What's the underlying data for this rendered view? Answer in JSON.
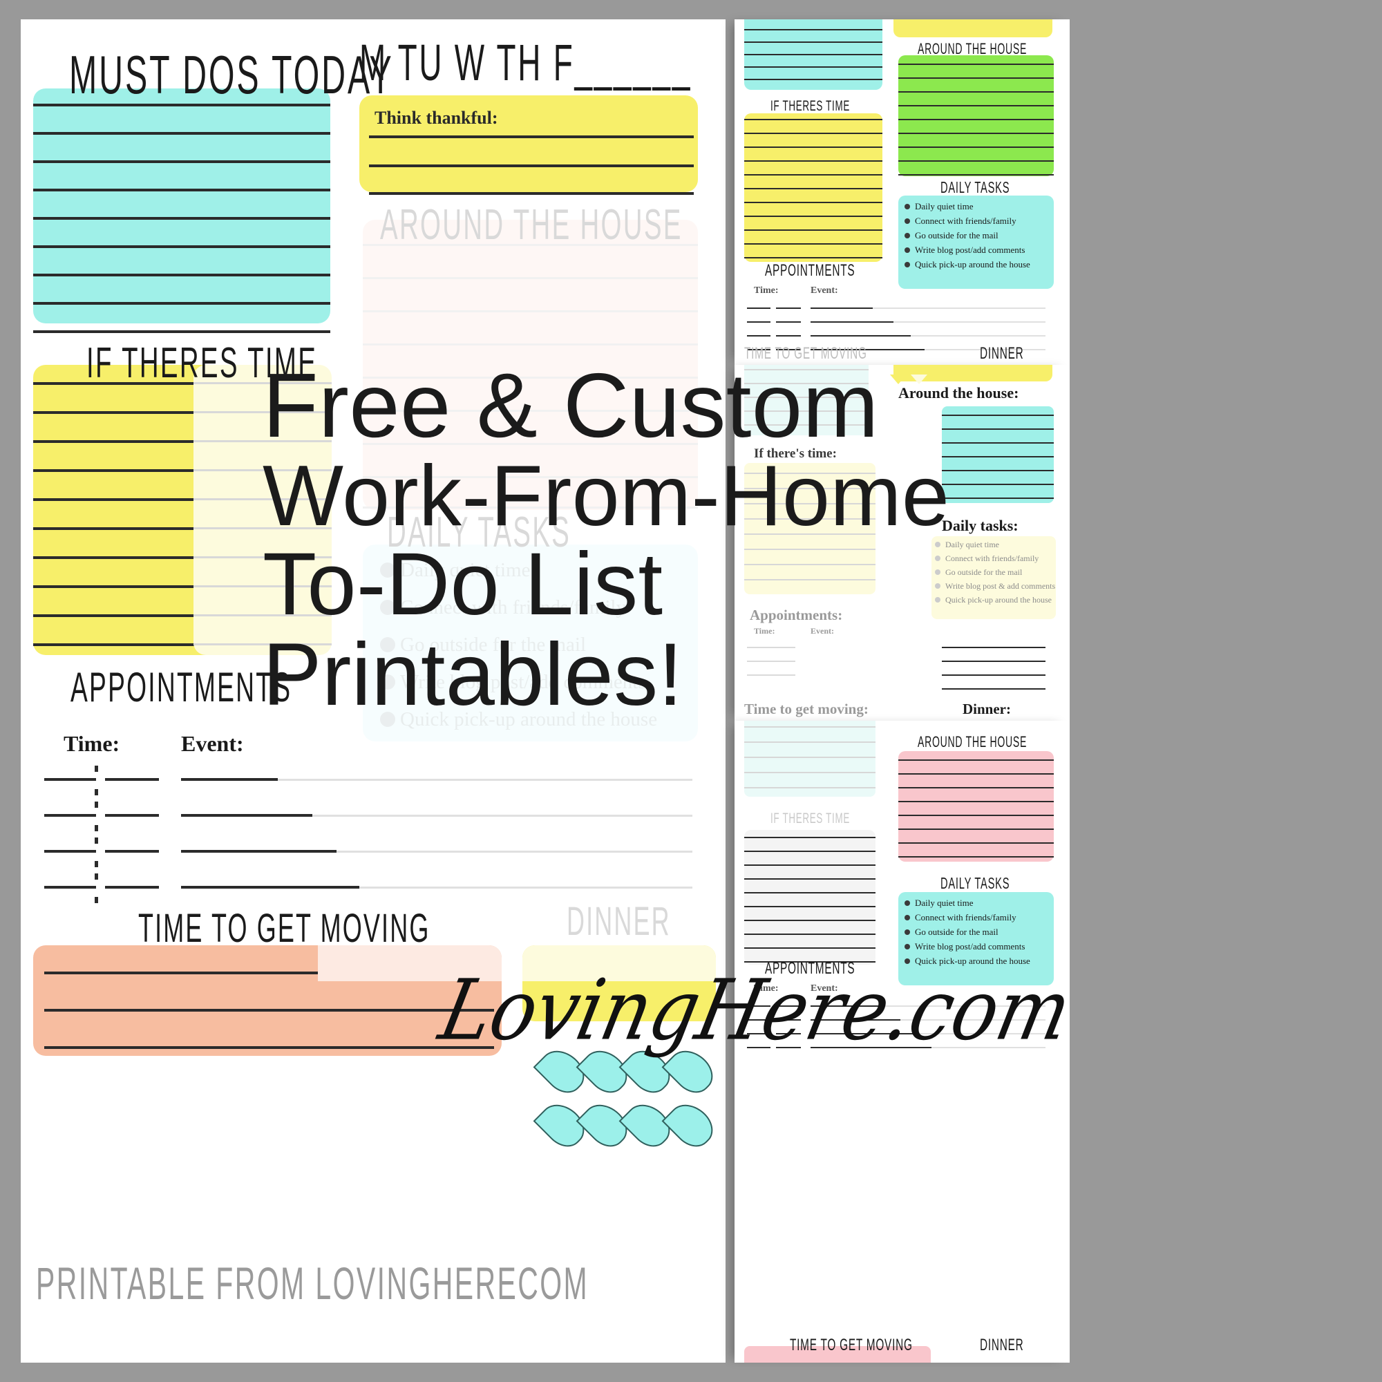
{
  "overlay": {
    "line1": "Free & Custom",
    "line2": "Work-From-Home",
    "line3": "To-Do List",
    "line4": "Printables!",
    "signature": "LovingHere.com"
  },
  "main_sheet": {
    "must_dos_title": "MUST DOS TODAY",
    "weekdays": "M  TU  W  TH  F______",
    "think_thankful_label": "Think thankful:",
    "around_the_house_title": "AROUND THE HOUSE",
    "if_theres_time_title": "IF THERES TIME",
    "daily_tasks_title": "DAILY TASKS",
    "daily_tasks": [
      "Daily quiet time",
      "Connect with friends/family",
      "Go outside  for the mail",
      "Write blog post/add comments",
      "Quick pick-up around the house"
    ],
    "appointments_title": "APPOINTMENTS",
    "appointments_time_label": "Time:",
    "appointments_event_label": "Event:",
    "time_to_get_moving_title": "TIME TO GET MOVING",
    "dinner_title": "DINNER",
    "footer": "Printable From LovingHerecom"
  },
  "thumbnails": [
    {
      "name": "thumbnail-top",
      "if_theres_time_title": "IF THERES TIME",
      "around_the_house_title": "AROUND THE HOUSE",
      "daily_tasks_title": "DAILY TASKS",
      "daily_tasks": [
        "Daily quiet time",
        "Connect with friends/family",
        "Go outside  for the mail",
        "Write blog post/add comments",
        "Quick pick-up around the house"
      ],
      "appointments_title": "APPOINTMENTS",
      "time_label": "Time:",
      "event_label": "Event:",
      "time_to_get_moving_title": "TIME TO GET MOVING",
      "dinner_title": "DINNER"
    },
    {
      "name": "thumbnail-middle",
      "around_the_house_title": "Around the house:",
      "if_theres_time_title": "If there's time:",
      "daily_tasks_title": "Daily tasks:",
      "daily_tasks": [
        "Daily quiet time",
        "Connect with friends/family",
        "Go outside  for the mail",
        "Write blog post & add comments",
        "Quick pick-up around the house"
      ],
      "appointments_title": "Appointments:",
      "time_label": "Time:",
      "event_label": "Event:",
      "time_to_get_moving_title": "Time to get moving:",
      "dinner_title": "Dinner:"
    },
    {
      "name": "thumbnail-bottom",
      "around_the_house_title": "AROUND THE HOUSE",
      "if_theres_time_title": "IF THERES TIME",
      "daily_tasks_title": "DAILY TASKS",
      "daily_tasks": [
        "Daily quiet time",
        "Connect with friends/family",
        "Go outside  for the mail",
        "Write blog post/add comments",
        "Quick pick-up around the house"
      ],
      "appointments_title": "APPOINTMENTS",
      "time_label": "Time:",
      "event_label": "Event:",
      "time_to_get_moving_title": "TIME TO GET MOVING",
      "dinner_title": "DINNER"
    }
  ],
  "colors": {
    "background": "#999999",
    "paper": "#ffffff",
    "cyan": "#9ff0e8",
    "yellow": "#f7ef6a",
    "green": "#8ce84e",
    "pink": "#f9c6cc",
    "peach": "#f7bda0",
    "blush": "#fdeae2",
    "ink": "#1a1a1a",
    "ghost": "#d9d9d9"
  }
}
